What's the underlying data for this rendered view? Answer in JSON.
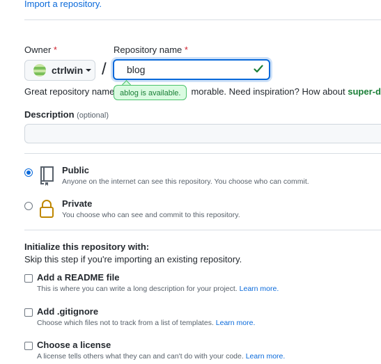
{
  "top_link": "Import a repository.",
  "owner": {
    "label": "Owner",
    "required_mark": "*",
    "name": "ctrlwin"
  },
  "slash": "/",
  "repo_name": {
    "label": "Repository name",
    "required_mark": "*",
    "value": "blog",
    "tooltip": "ablog is available."
  },
  "hint": {
    "prefix": "Great repository names",
    "middle": "morable. Need inspiration? How about",
    "suggestion": "super-dupe"
  },
  "description": {
    "label": "Description",
    "optional": "(optional)",
    "value": ""
  },
  "visibility": [
    {
      "title": "Public",
      "desc": "Anyone on the internet can see this repository. You choose who can commit.",
      "checked": true
    },
    {
      "title": "Private",
      "desc": "You choose who can see and commit to this repository.",
      "checked": false
    }
  ],
  "init": {
    "heading": "Initialize this repository with:",
    "subheading": "Skip this step if you're importing an existing repository.",
    "options": [
      {
        "title": "Add a README file",
        "desc": "This is where you can write a long description for your project.",
        "link": "Learn more."
      },
      {
        "title": "Add .gitignore",
        "desc": "Choose which files not to track from a list of templates.",
        "link": "Learn more."
      },
      {
        "title": "Choose a license",
        "desc": "A license tells others what they can and can't do with your code.",
        "link": "Learn more."
      }
    ]
  },
  "colors": {
    "accent": "#0969da",
    "success": "#1a7f37",
    "required": "#cf222e"
  }
}
